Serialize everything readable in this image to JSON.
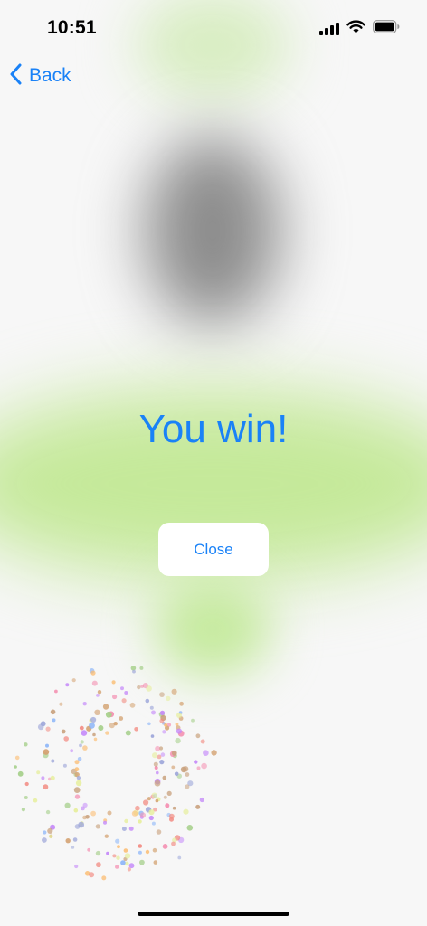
{
  "status_bar": {
    "time": "10:51",
    "icons": [
      "cellular-signal-icon",
      "wifi-icon",
      "battery-icon"
    ]
  },
  "nav": {
    "back_label": "Back",
    "back_icon": "chevron-left-icon"
  },
  "main": {
    "title": "You win!",
    "close_label": "Close"
  },
  "colors": {
    "accent": "#1a82f7",
    "background": "#f7f7f7",
    "green_glow": "#c5e99a",
    "gray_glow": "#8c8c8c"
  }
}
